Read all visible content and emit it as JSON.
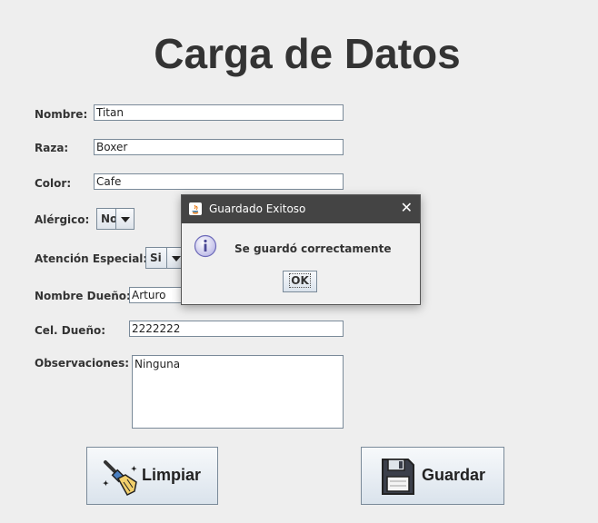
{
  "title": "Carga de Datos",
  "form": {
    "nombre_label": "Nombre:",
    "nombre_value": "Titan",
    "raza_label": "Raza:",
    "raza_value": "Boxer",
    "color_label": "Color:",
    "color_value": "Cafe",
    "alergico_label": "Alérgico:",
    "alergico_value": "No",
    "atencion_label": "Atención Especial:",
    "atencion_value": "Si",
    "dueno_label": "Nombre Dueño:",
    "dueno_value": "Arturo",
    "cel_label": "Cel. Dueño:",
    "cel_value": "2222222",
    "obs_label": "Observaciones:",
    "obs_value": "Ninguna"
  },
  "buttons": {
    "limpiar": "Limpiar",
    "guardar": "Guardar"
  },
  "dialog": {
    "title": "Guardado Exitoso",
    "message": "Se guardó correctamente",
    "ok": "OK",
    "close": "✕"
  },
  "icons": {
    "dialog": "java-icon",
    "info": "info-icon",
    "close": "close-icon",
    "limpiar": "broom-icon",
    "guardar": "floppy-disk-icon",
    "combo": "chevron-down-icon"
  },
  "colors": {
    "background": "#eeeeee",
    "titlebar": "#444444",
    "button_top": "#f7f9fb",
    "button_bottom": "#dae3ec"
  }
}
